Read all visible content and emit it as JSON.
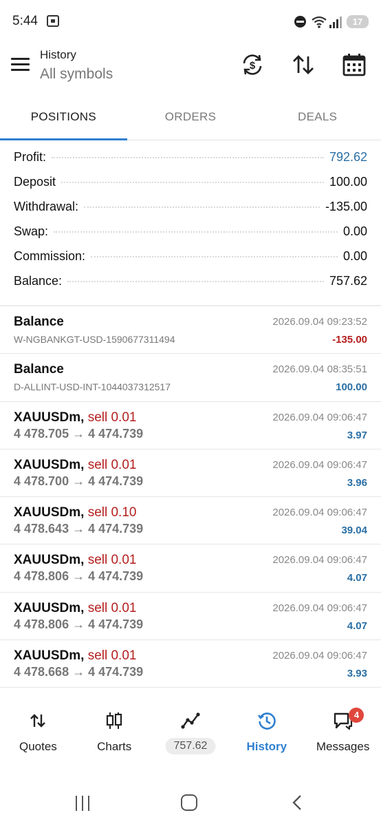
{
  "status_bar": {
    "time": "5:44",
    "battery": "17"
  },
  "header": {
    "title": "History",
    "subtitle": "All symbols"
  },
  "tabs": [
    {
      "label": "POSITIONS"
    },
    {
      "label": "ORDERS"
    },
    {
      "label": "DEALS"
    }
  ],
  "summary": [
    {
      "label": "Profit:",
      "value": "792.62"
    },
    {
      "label": "Deposit",
      "value": "100.00"
    },
    {
      "label": "Withdrawal:",
      "value": "-135.00"
    },
    {
      "label": "Swap:",
      "value": "0.00"
    },
    {
      "label": "Commission:",
      "value": "0.00"
    },
    {
      "label": "Balance:",
      "value": "757.62"
    }
  ],
  "deals": [
    {
      "title": "Balance",
      "sub": "W-NGBANKGT-USD-1590677311494",
      "time": "2026.09.04 09:23:52",
      "amount": "-135.00"
    },
    {
      "title": "Balance",
      "sub": "D-ALLINT-USD-INT-1044037312517",
      "time": "2026.09.04 08:35:51",
      "amount": "100.00"
    },
    {
      "symbol": "XAUUSDm,",
      "side": "sell 0.01",
      "prices": "4 478.705 → 4 474.739",
      "time": "2026.09.04 09:06:47",
      "amount": "3.97"
    },
    {
      "symbol": "XAUUSDm,",
      "side": "sell 0.01",
      "prices": "4 478.700 → 4 474.739",
      "time": "2026.09.04 09:06:47",
      "amount": "3.96"
    },
    {
      "symbol": "XAUUSDm,",
      "side": "sell 0.10",
      "prices": "4 478.643 → 4 474.739",
      "time": "2026.09.04 09:06:47",
      "amount": "39.04"
    },
    {
      "symbol": "XAUUSDm,",
      "side": "sell 0.01",
      "prices": "4 478.806 → 4 474.739",
      "time": "2026.09.04 09:06:47",
      "amount": "4.07"
    },
    {
      "symbol": "XAUUSDm,",
      "side": "sell 0.01",
      "prices": "4 478.806 → 4 474.739",
      "time": "2026.09.04 09:06:47",
      "amount": "4.07"
    },
    {
      "symbol": "XAUUSDm,",
      "side": "sell 0.01",
      "prices": "4 478.668 → 4 474.739",
      "time": "2026.09.04 09:06:47",
      "amount": "3.93"
    }
  ],
  "bottom_nav": {
    "quotes": "Quotes",
    "charts": "Charts",
    "balance": "757.62",
    "history": "History",
    "messages": "Messages",
    "messages_badge": "4"
  },
  "colors": {
    "accent": "#2f7fd0",
    "profit_blue": "#2a6fa5",
    "loss_red": "#b41e1e",
    "badge": "#e0473c"
  }
}
